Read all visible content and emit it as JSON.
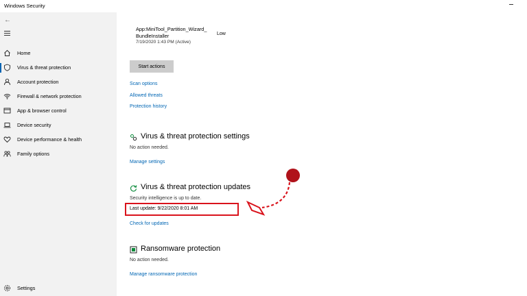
{
  "window": {
    "title": "Windows Security"
  },
  "nav": {
    "items": [
      {
        "label": "Home",
        "icon": "home-icon"
      },
      {
        "label": "Virus & threat protection",
        "icon": "shield-icon",
        "active": true
      },
      {
        "label": "Account protection",
        "icon": "person-icon"
      },
      {
        "label": "Firewall & network protection",
        "icon": "wifi-icon"
      },
      {
        "label": "App & browser control",
        "icon": "browser-icon"
      },
      {
        "label": "Device security",
        "icon": "laptop-icon"
      },
      {
        "label": "Device performance & health",
        "icon": "heart-icon"
      },
      {
        "label": "Family options",
        "icon": "family-icon"
      }
    ],
    "settings_label": "Settings"
  },
  "threat": {
    "app_name": "App:MiniTool_Partition_Wizard_ BundleInstaller",
    "severity": "Low",
    "date": "7/19/2020 1:43 PM (Active)",
    "start_actions": "Start actions"
  },
  "links": {
    "scan_options": "Scan options",
    "allowed_threats": "Allowed threats",
    "protection_history": "Protection history"
  },
  "settings_section": {
    "title": "Virus & threat protection settings",
    "status": "No action needed.",
    "link": "Manage settings"
  },
  "updates_section": {
    "title": "Virus & threat protection updates",
    "status": "Security intelligence is up to date.",
    "last_update": "Last update: 9/22/2020 8:01 AM",
    "link": "Check for updates"
  },
  "ransomware_section": {
    "title": "Ransomware protection",
    "status": "No action needed.",
    "link": "Manage ransomware protection"
  },
  "colors": {
    "link": "#0066b4",
    "annotation_red": "#d9121b",
    "annotation_dot": "#b0121a"
  }
}
